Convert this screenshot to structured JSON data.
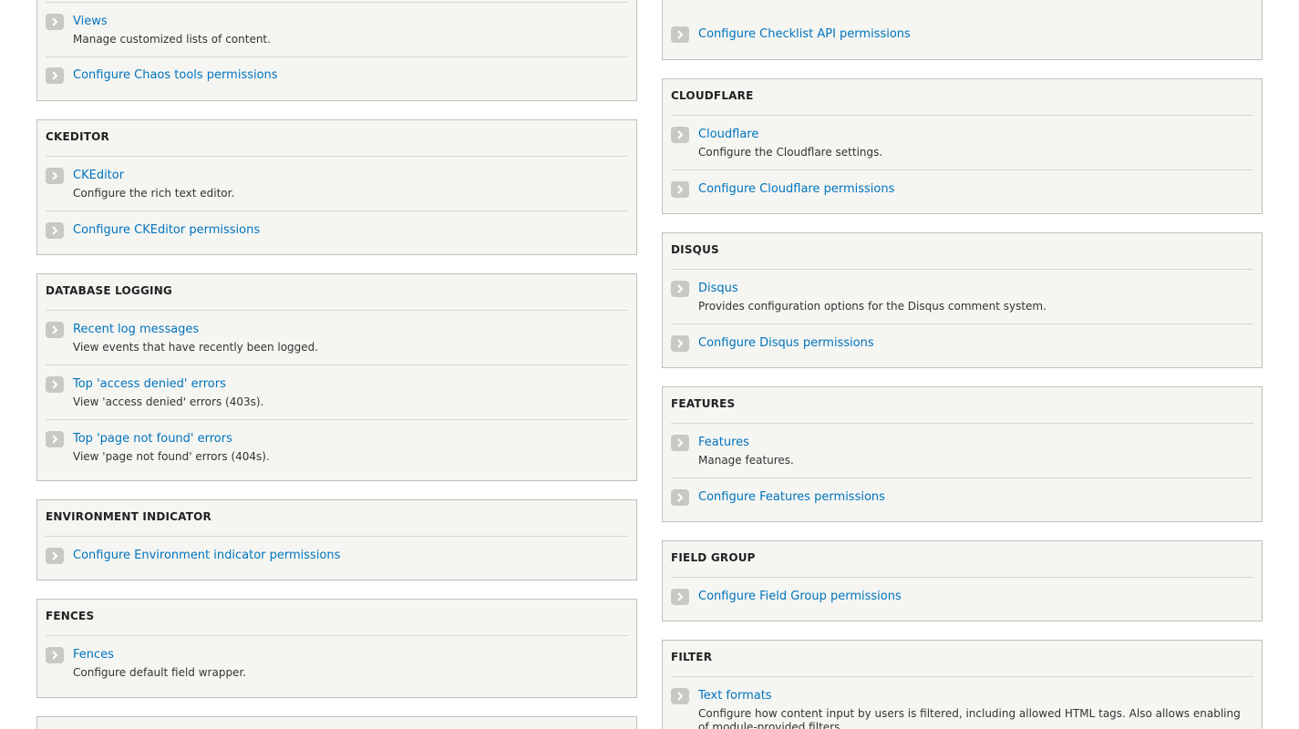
{
  "left_column": [
    {
      "title": "",
      "items": [
        {
          "label": "Views",
          "description": "Manage customized lists of content."
        },
        {
          "label": "Configure Chaos tools permissions",
          "description": ""
        }
      ]
    },
    {
      "title": "CKEDITOR",
      "items": [
        {
          "label": "CKEditor",
          "description": "Configure the rich text editor."
        },
        {
          "label": "Configure CKEditor permissions",
          "description": ""
        }
      ]
    },
    {
      "title": "DATABASE LOGGING",
      "items": [
        {
          "label": "Recent log messages",
          "description": "View events that have recently been logged."
        },
        {
          "label": "Top 'access denied' errors",
          "description": "View 'access denied' errors (403s)."
        },
        {
          "label": "Top 'page not found' errors",
          "description": "View 'page not found' errors (404s)."
        }
      ]
    },
    {
      "title": "ENVIRONMENT INDICATOR",
      "items": [
        {
          "label": "Configure Environment indicator permissions",
          "description": ""
        }
      ]
    },
    {
      "title": "FENCES",
      "items": [
        {
          "label": "Fences",
          "description": "Configure default field wrapper."
        }
      ]
    },
    {
      "title": "",
      "items": []
    }
  ],
  "right_column": [
    {
      "title": "",
      "items": [
        {
          "label": "Configure Checklist API permissions",
          "description": ""
        }
      ]
    },
    {
      "title": "CLOUDFLARE",
      "items": [
        {
          "label": "Cloudflare",
          "description": "Configure the Cloudflare settings."
        },
        {
          "label": "Configure Cloudflare permissions",
          "description": ""
        }
      ]
    },
    {
      "title": "DISQUS",
      "items": [
        {
          "label": "Disqus",
          "description": "Provides configuration options for the Disqus comment system."
        },
        {
          "label": "Configure Disqus permissions",
          "description": ""
        }
      ]
    },
    {
      "title": "FEATURES",
      "items": [
        {
          "label": "Features",
          "description": "Manage features."
        },
        {
          "label": "Configure Features permissions",
          "description": ""
        }
      ]
    },
    {
      "title": "FIELD GROUP",
      "items": [
        {
          "label": "Configure Field Group permissions",
          "description": ""
        }
      ]
    },
    {
      "title": "FILTER",
      "items": [
        {
          "label": "Text formats",
          "description": "Configure how content input by users is filtered, including allowed HTML tags. Also allows enabling of module-provided filters."
        }
      ]
    }
  ],
  "icons": {
    "item_arrow": "chevron-right-icon"
  },
  "colors": {
    "link": "#0074bd",
    "panel_bg": "#f5f5f2",
    "panel_border": "#bfbfba"
  }
}
